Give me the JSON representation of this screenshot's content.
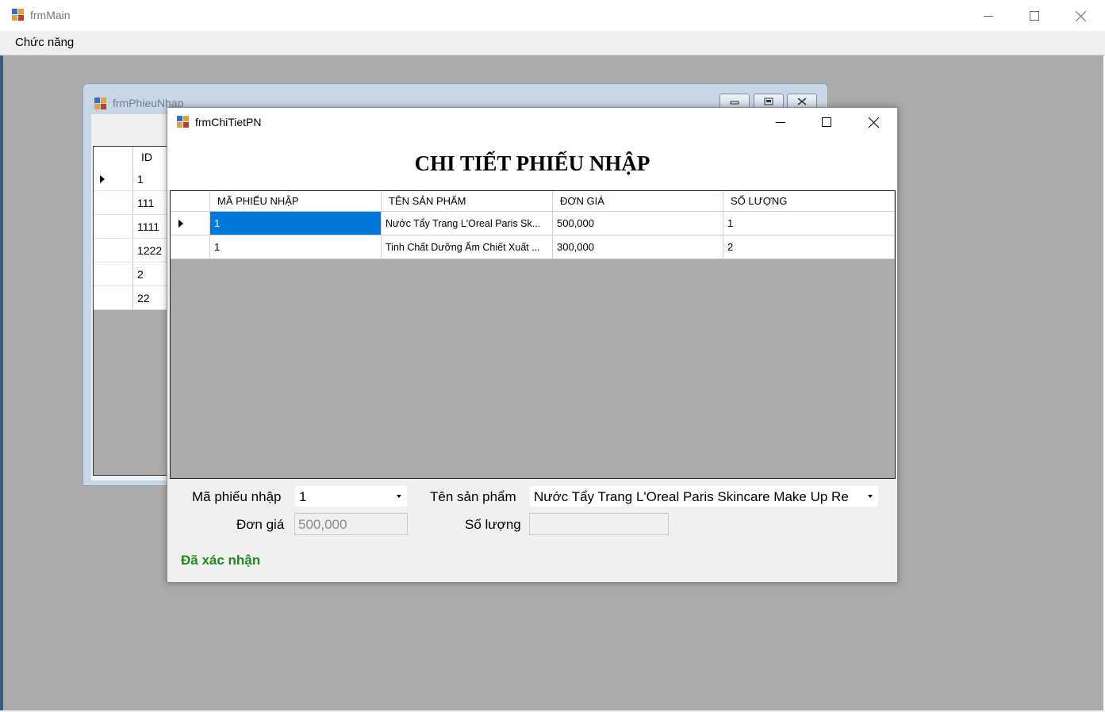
{
  "main_window": {
    "title": "frmMain",
    "menu": [
      "Chức năng"
    ]
  },
  "phieu_nhap_window": {
    "title": "frmPhieuNhap",
    "grid": {
      "header": "ID",
      "rows": [
        "1",
        "111",
        "1111",
        "1222",
        "2",
        "22"
      ]
    }
  },
  "chi_tiet_window": {
    "title": "frmChiTietPN",
    "heading": "CHI TIẾT PHIẾU NHẬP",
    "columns": [
      "MÃ PHIẾU NHẬP",
      "TÊN SẢN PHẨM",
      "ĐƠN GIÁ",
      "SỐ LƯỢNG"
    ],
    "rows": [
      {
        "ma_phieu_nhap": "1",
        "ten_san_pham": "Nước Tẩy Trang L'Oreal Paris Sk...",
        "don_gia": "500,000",
        "so_luong": "1"
      },
      {
        "ma_phieu_nhap": "1",
        "ten_san_pham": "Tinh Chất Dưỡng Ẩm Chiết Xuất ...",
        "don_gia": "300,000",
        "so_luong": "2"
      }
    ],
    "form": {
      "ma_phieu_nhap_label": "Mã phiếu nhập",
      "ma_phieu_nhap_value": "1",
      "ten_san_pham_label": "Tên sản phẩm",
      "ten_san_pham_value": "Nước Tẩy Trang L'Oreal Paris Skincare Make Up Re",
      "don_gia_label": "Đơn giá",
      "don_gia_value": "500,000",
      "so_luong_label": "Số lượng",
      "so_luong_value": ""
    },
    "status": "Đã xác nhận"
  },
  "colors": {
    "mdi_background": "#ababab",
    "selection": "#0078d7",
    "status_text": "#1f8a1f"
  }
}
